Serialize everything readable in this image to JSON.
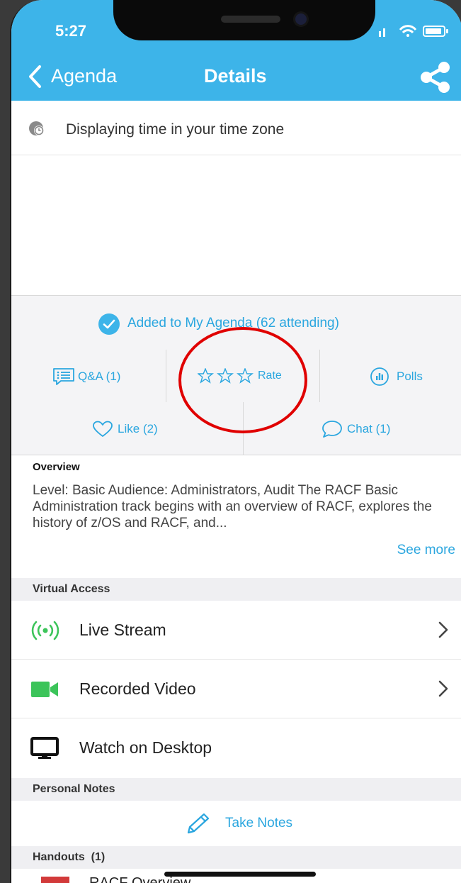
{
  "status_bar": {
    "time": "5:27"
  },
  "nav": {
    "back_label": "Agenda",
    "title": "Details"
  },
  "timezone": {
    "text": "Displaying time in your time zone"
  },
  "agenda_status": {
    "text": "Added to My Agenda (62 attending)"
  },
  "actions": {
    "qa": "Q&A (1)",
    "rate": "Rate",
    "polls": "Polls",
    "like": "Like (2)",
    "chat": "Chat (1)"
  },
  "overview": {
    "heading": "Overview",
    "text": "Level: Basic Audience: Administrators, Audit The RACF Basic Administration track begins with an overview of RACF, explores the history of z/OS and RACF, and...",
    "see_more": "See more"
  },
  "virtual_access": {
    "heading": "Virtual Access",
    "items": [
      {
        "label": "Live Stream",
        "icon": "live-stream-icon"
      },
      {
        "label": "Recorded Video",
        "icon": "video-camera-icon"
      },
      {
        "label": "Watch on Desktop",
        "icon": "desktop-monitor-icon"
      }
    ]
  },
  "personal_notes": {
    "heading": "Personal Notes",
    "take_notes": "Take Notes"
  },
  "handouts": {
    "heading": "Handouts  (1)",
    "first_item_partial": "RACF Overview"
  },
  "colors": {
    "accent": "#3db4e9",
    "link": "#2aa6df",
    "live_green": "#3cc45a",
    "annotation_red": "#e00000"
  }
}
